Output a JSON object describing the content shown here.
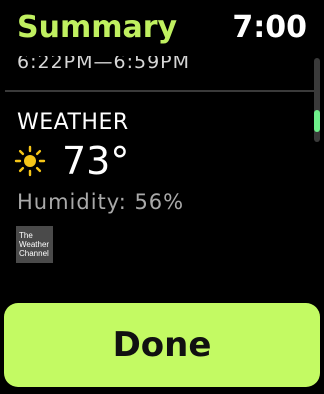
{
  "header": {
    "title": "Summary",
    "time": "7:00"
  },
  "event": {
    "time_range": "6:22PM—6:59PM"
  },
  "weather": {
    "section_title": "WEATHER",
    "icon": "sun-icon",
    "temperature": "73°",
    "humidity": "Humidity: 56%",
    "logo_text": "The\nWeather\nChannel"
  },
  "actions": {
    "done_label": "Done"
  },
  "colors": {
    "title_green": "#c0f060",
    "button_green": "#c3fa63",
    "scroll_thumb": "#6ef08a",
    "sun_yellow": "#f5c518"
  }
}
